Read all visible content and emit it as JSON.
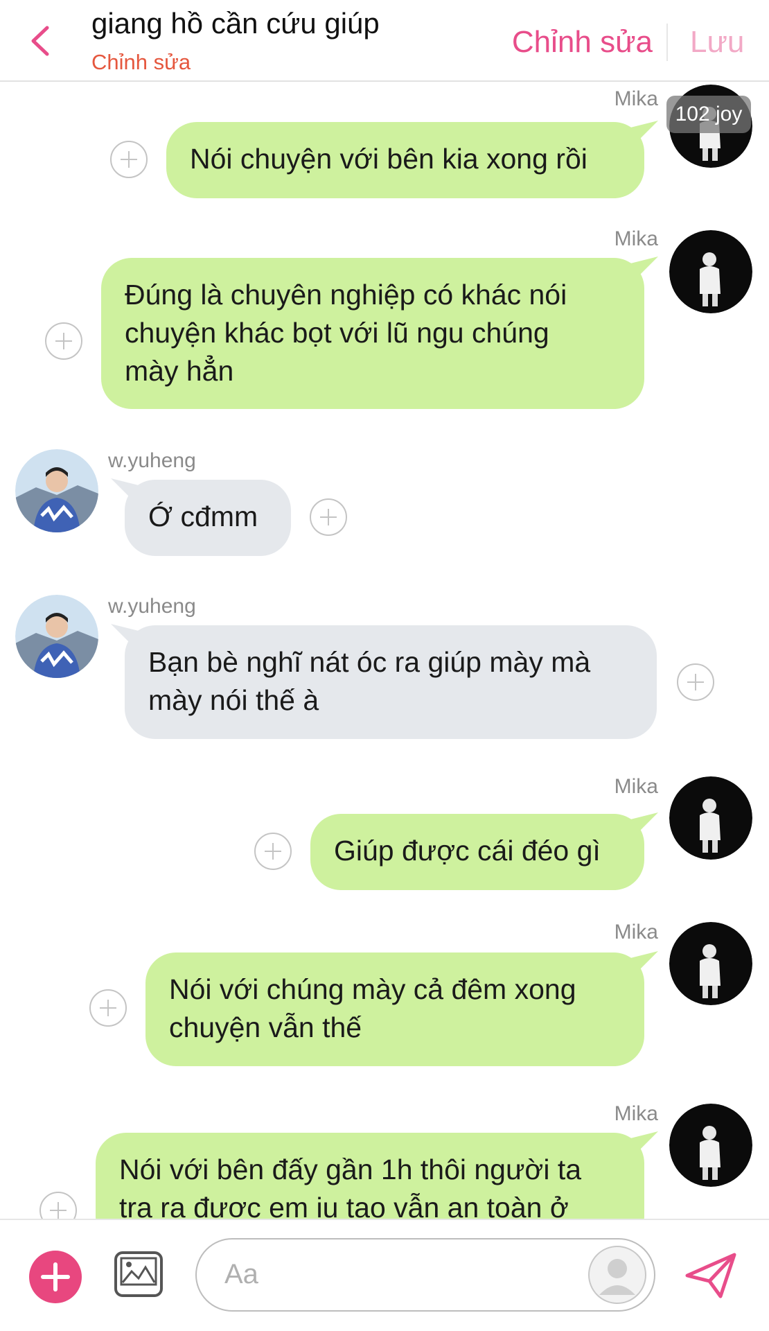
{
  "header": {
    "title": "giang hồ cần cứu giúp",
    "subtitle": "Chỉnh sửa",
    "edit_label": "Chỉnh sửa",
    "save_label": "Lưu"
  },
  "badge": {
    "text": "102 joy"
  },
  "messages": [
    {
      "sender": "Mika",
      "side": "me",
      "lines": [
        "Nói chuyện với bên kia xong rồi"
      ]
    },
    {
      "sender": "Mika",
      "side": "me",
      "lines": [
        "Đúng là chuyên nghiệp có khác nói",
        "chuyện khác bọt với lũ ngu chúng",
        "mày hẳn"
      ]
    },
    {
      "sender": "w.yuheng",
      "side": "other",
      "lines": [
        "Ớ cđmm"
      ]
    },
    {
      "sender": "w.yuheng",
      "side": "other",
      "lines": [
        "Bạn bè nghĩ nát óc ra giúp mày mà",
        "mày nói thế à"
      ]
    },
    {
      "sender": "Mika",
      "side": "me",
      "lines": [
        "Giúp được cái đéo gì"
      ]
    },
    {
      "sender": "Mika",
      "side": "me",
      "lines": [
        "Nói với chúng mày cả đêm xong",
        "chuyện vẫn thế"
      ]
    },
    {
      "sender": "Mika",
      "side": "me",
      "lines": [
        "Nói với bên đấy gần 1h thôi người ta",
        "tra ra được em iu tao vẫn an toàn ở"
      ]
    }
  ],
  "composer": {
    "placeholder": "Aa"
  },
  "icons": {
    "back": "chevron-left-icon",
    "plus": "plus-circle-icon",
    "add": "add-icon",
    "image": "image-icon",
    "send": "send-icon",
    "avatar": "user-avatar-icon"
  },
  "colors": {
    "accent": "#e84d8a",
    "subtitle": "#e5573e",
    "my_bubble": "#cef19e",
    "other_bubble": "#e5e8ec"
  }
}
